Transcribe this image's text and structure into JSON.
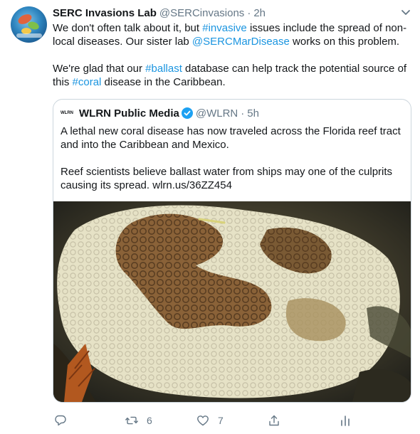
{
  "tweet": {
    "author_name": "SERC Invasions Lab",
    "author_handle": "@SERCinvasions",
    "separator": "·",
    "time": "2h",
    "para1": [
      {
        "text": "We don't often talk about it, but ",
        "kind": "plain"
      },
      {
        "text": "#invasive",
        "kind": "link"
      },
      {
        "text": " issues include the spread of non-local diseases. Our sister lab ",
        "kind": "plain"
      },
      {
        "text": "@SERCMarDisease",
        "kind": "link"
      },
      {
        "text": " works on this problem.",
        "kind": "plain"
      }
    ],
    "para2": [
      {
        "text": "We're glad that our ",
        "kind": "plain"
      },
      {
        "text": "#ballast",
        "kind": "link"
      },
      {
        "text": " database can help track the potential source of this ",
        "kind": "plain"
      },
      {
        "text": "#coral",
        "kind": "link"
      },
      {
        "text": " disease in the Caribbean.",
        "kind": "plain"
      }
    ]
  },
  "quoted": {
    "logo_text": "WLRN",
    "author_name": "WLRN Public Media",
    "author_handle": "@WLRN",
    "separator": "·",
    "time": "5h",
    "para1": "A lethal new coral disease has now traveled across the Florida reef tract and into the Caribbean and Mexico.",
    "para2": "Reef scientists believe ballast water from ships may one of the culprits causing its spread. wlrn.us/36ZZ454"
  },
  "actions": {
    "replies": "",
    "retweets": "6",
    "likes": "7"
  },
  "colors": {
    "link": "#1b95e0",
    "muted": "#657786",
    "verified": "#1da1f2"
  }
}
